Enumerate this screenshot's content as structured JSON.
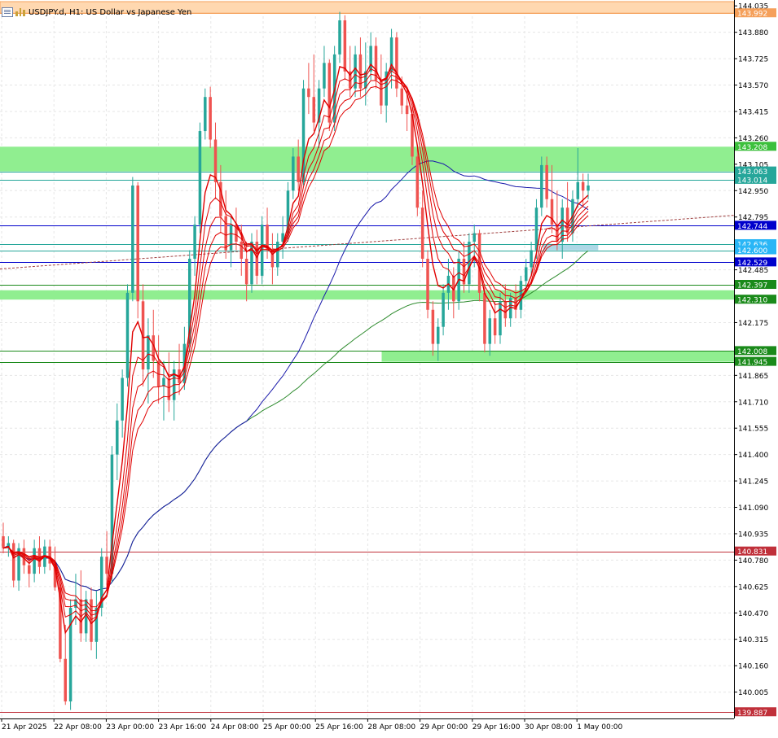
{
  "window": {
    "symbol_title": "USDJPY.d, H1:  US Dollar vs Japanese Yen"
  },
  "colors": {
    "background": "#ffffff",
    "grid": "#e6e6e6",
    "bull_candle": "#26a69a",
    "bear_candle": "#ef5350",
    "ribbon_red": "#e00000",
    "ma_blue": "#1a1aaa",
    "ma_green": "#2e8b2e",
    "zone_green": "#90ee90",
    "zone_orange": "#ffd8b0",
    "level_blue": "#0000cc",
    "level_teal": "#26a69a",
    "level_green": "#1a8a1a",
    "level_red": "#c0303a",
    "trend_dotted": "#a04040",
    "axis_text": "#000000"
  },
  "chart_data": {
    "type": "candlestick",
    "symbol": "USDJPY.d",
    "timeframe": "H1",
    "description": "US Dollar vs Japanese Yen",
    "ylim": [
      139.85,
      144.06
    ],
    "y_ticks": [
      "144.035",
      "143.880",
      "143.725",
      "143.570",
      "143.415",
      "143.260",
      "143.105",
      "142.950",
      "142.795",
      "142.485",
      "142.175",
      "141.865",
      "141.710",
      "141.555",
      "141.400",
      "141.245",
      "141.090",
      "140.935",
      "140.780",
      "140.625",
      "140.470",
      "140.315",
      "140.160",
      "140.005"
    ],
    "x_ticks": [
      "21 Apr 2025",
      "22 Apr 08:00",
      "23 Apr 00:00",
      "23 Apr 16:00",
      "24 Apr 08:00",
      "25 Apr 00:00",
      "25 Apr 16:00",
      "28 Apr 08:00",
      "29 Apr 00:00",
      "29 Apr 16:00",
      "30 Apr 08:00",
      "1 May 00:00"
    ],
    "price_labels": [
      {
        "value": "143.992",
        "price": 143.992,
        "color": "#f5a05a",
        "text_color": "#ffffff"
      },
      {
        "value": "143.208",
        "price": 143.208,
        "color": "#3cc03c",
        "text_color": "#ffffff"
      },
      {
        "value": "143.063",
        "price": 143.063,
        "color": "#26a69a",
        "text_color": "#ffffff"
      },
      {
        "value": "143.014",
        "price": 143.014,
        "color": "#26a69a",
        "text_color": "#ffffff"
      },
      {
        "value": "142.744",
        "price": 142.744,
        "color": "#0000cc",
        "text_color": "#ffffff"
      },
      {
        "value": "142.636",
        "price": 142.636,
        "color": "#29b6f6",
        "text_color": "#ffffff"
      },
      {
        "value": "142.600",
        "price": 142.6,
        "color": "#29b6f6",
        "text_color": "#ffffff"
      },
      {
        "value": "142.529",
        "price": 142.529,
        "color": "#0000cc",
        "text_color": "#ffffff"
      },
      {
        "value": "142.397",
        "price": 142.397,
        "color": "#1a8a1a",
        "text_color": "#ffffff"
      },
      {
        "value": "142.310",
        "price": 142.31,
        "color": "#1a8a1a",
        "text_color": "#ffffff"
      },
      {
        "value": "142.008",
        "price": 142.008,
        "color": "#1a8a1a",
        "text_color": "#ffffff"
      },
      {
        "value": "141.945",
        "price": 141.945,
        "color": "#1a8a1a",
        "text_color": "#ffffff"
      },
      {
        "value": "140.831",
        "price": 140.831,
        "color": "#c0303a",
        "text_color": "#ffffff"
      },
      {
        "value": "139.887",
        "price": 139.887,
        "color": "#c0303a",
        "text_color": "#ffffff"
      }
    ],
    "levels": [
      {
        "price": 143.992,
        "color": "#f5a05a"
      },
      {
        "price": 143.063,
        "color": "#26a69a"
      },
      {
        "price": 143.014,
        "color": "#26a69a"
      },
      {
        "price": 142.744,
        "color": "#0000cc"
      },
      {
        "price": 142.636,
        "color": "#26a69a"
      },
      {
        "price": 142.6,
        "color": "#26a69a"
      },
      {
        "price": 142.529,
        "color": "#0000cc"
      },
      {
        "price": 142.397,
        "color": "#1a8a1a"
      },
      {
        "price": 142.008,
        "color": "#1a8a1a"
      },
      {
        "price": 141.945,
        "color": "#1a8a1a"
      },
      {
        "price": 140.831,
        "color": "#c0303a"
      },
      {
        "price": 139.887,
        "color": "#c0303a"
      }
    ],
    "zones": [
      {
        "top": 144.06,
        "bottom": 143.992,
        "color": "#ffd8b0",
        "border": "#f5a05a",
        "from": 0,
        "to": 1
      },
      {
        "top": 143.208,
        "bottom": 143.063,
        "color": "#90ee90",
        "from": 0,
        "to": 1
      },
      {
        "top": 142.365,
        "bottom": 142.31,
        "color": "#90ee90",
        "from": 0,
        "to": 1
      },
      {
        "top": 142.008,
        "bottom": 141.945,
        "color": "#90ee90",
        "from": 0.52,
        "to": 1
      },
      {
        "top": 142.636,
        "bottom": 142.6,
        "color": "#add8e6",
        "from": 0.74,
        "to": 0.815
      }
    ],
    "trendline": {
      "x1": 0.0,
      "p1": 142.49,
      "x2": 1.0,
      "p2": 142.805
    },
    "candles": [
      [
        140.92,
        141.0,
        140.82,
        140.85
      ],
      [
        140.85,
        140.92,
        140.8,
        140.88
      ],
      [
        140.88,
        140.9,
        140.62,
        140.66
      ],
      [
        140.66,
        140.88,
        140.6,
        140.85
      ],
      [
        140.85,
        140.9,
        140.7,
        140.75
      ],
      [
        140.75,
        140.8,
        140.62,
        140.7
      ],
      [
        140.7,
        140.9,
        140.65,
        140.85
      ],
      [
        140.85,
        140.92,
        140.7,
        140.74
      ],
      [
        140.74,
        140.9,
        140.7,
        140.86
      ],
      [
        140.86,
        140.9,
        140.72,
        140.76
      ],
      [
        140.76,
        140.86,
        140.6,
        140.62
      ],
      [
        140.62,
        140.65,
        140.18,
        140.2
      ],
      [
        140.2,
        140.4,
        139.93,
        139.95
      ],
      [
        139.95,
        140.55,
        139.9,
        140.5
      ],
      [
        140.5,
        140.7,
        140.4,
        140.55
      ],
      [
        140.55,
        140.72,
        140.3,
        140.35
      ],
      [
        140.35,
        140.6,
        140.3,
        140.55
      ],
      [
        140.55,
        140.62,
        140.25,
        140.3
      ],
      [
        140.3,
        140.6,
        140.2,
        140.5
      ],
      [
        140.5,
        140.85,
        140.45,
        140.8
      ],
      [
        140.8,
        140.95,
        140.6,
        140.7
      ],
      [
        140.7,
        141.45,
        140.65,
        141.4
      ],
      [
        141.4,
        141.7,
        141.25,
        141.6
      ],
      [
        141.6,
        141.9,
        141.5,
        141.85
      ],
      [
        141.85,
        142.4,
        141.8,
        142.35
      ],
      [
        142.35,
        143.03,
        142.3,
        142.98
      ],
      [
        142.98,
        143.0,
        142.2,
        142.3
      ],
      [
        142.3,
        142.4,
        141.8,
        141.9
      ],
      [
        141.9,
        142.2,
        141.7,
        142.1
      ],
      [
        142.1,
        142.25,
        141.85,
        141.95
      ],
      [
        141.95,
        142.1,
        141.7,
        141.8
      ],
      [
        141.8,
        141.95,
        141.6,
        141.85
      ],
      [
        141.85,
        142.0,
        141.65,
        141.72
      ],
      [
        141.72,
        141.95,
        141.6,
        141.9
      ],
      [
        141.9,
        142.05,
        141.75,
        141.82
      ],
      [
        141.82,
        142.15,
        141.78,
        142.05
      ],
      [
        142.05,
        142.6,
        142.0,
        142.55
      ],
      [
        142.55,
        142.8,
        142.45,
        142.75
      ],
      [
        142.75,
        143.35,
        142.7,
        143.3
      ],
      [
        143.3,
        143.55,
        143.25,
        143.5
      ],
      [
        143.5,
        143.56,
        143.2,
        143.25
      ],
      [
        143.25,
        143.35,
        142.9,
        143.0
      ],
      [
        143.0,
        143.1,
        142.7,
        142.8
      ],
      [
        142.8,
        142.95,
        142.55,
        142.6
      ],
      [
        142.6,
        142.8,
        142.5,
        142.75
      ],
      [
        142.75,
        142.85,
        142.6,
        142.65
      ],
      [
        142.65,
        142.75,
        142.45,
        142.55
      ],
      [
        142.55,
        142.65,
        142.3,
        142.4
      ],
      [
        142.4,
        142.7,
        142.35,
        142.65
      ],
      [
        142.65,
        142.72,
        142.4,
        142.45
      ],
      [
        142.45,
        142.8,
        142.4,
        142.75
      ],
      [
        142.75,
        142.85,
        142.55,
        142.6
      ],
      [
        142.6,
        142.7,
        142.4,
        142.5
      ],
      [
        142.5,
        142.7,
        142.45,
        142.65
      ],
      [
        142.65,
        142.8,
        142.55,
        142.7
      ],
      [
        142.7,
        143.0,
        142.65,
        142.95
      ],
      [
        142.95,
        143.2,
        142.9,
        143.15
      ],
      [
        143.15,
        143.25,
        142.95,
        143.0
      ],
      [
        143.0,
        143.6,
        142.98,
        143.55
      ],
      [
        143.55,
        143.7,
        143.4,
        143.5
      ],
      [
        143.5,
        143.75,
        143.3,
        143.35
      ],
      [
        143.35,
        143.6,
        143.2,
        143.55
      ],
      [
        143.55,
        143.8,
        143.5,
        143.7
      ],
      [
        143.7,
        143.72,
        143.3,
        143.35
      ],
      [
        143.35,
        143.8,
        143.3,
        143.75
      ],
      [
        143.75,
        144.0,
        143.7,
        143.95
      ],
      [
        143.95,
        143.98,
        143.6,
        143.65
      ],
      [
        143.65,
        143.8,
        143.5,
        143.55
      ],
      [
        143.55,
        143.8,
        143.5,
        143.75
      ],
      [
        143.75,
        143.85,
        143.5,
        143.55
      ],
      [
        143.55,
        143.82,
        143.45,
        143.65
      ],
      [
        143.65,
        143.88,
        143.6,
        143.8
      ],
      [
        143.8,
        143.85,
        143.55,
        143.6
      ],
      [
        143.6,
        143.75,
        143.4,
        143.45
      ],
      [
        143.45,
        143.7,
        143.35,
        143.65
      ],
      [
        143.65,
        143.9,
        143.55,
        143.85
      ],
      [
        143.85,
        143.88,
        143.5,
        143.55
      ],
      [
        143.55,
        143.62,
        143.4,
        143.45
      ],
      [
        143.45,
        143.55,
        143.3,
        143.4
      ],
      [
        143.4,
        143.45,
        143.1,
        143.15
      ],
      [
        143.15,
        143.2,
        142.8,
        142.85
      ],
      [
        142.85,
        142.95,
        142.5,
        142.55
      ],
      [
        142.55,
        142.6,
        142.2,
        142.25
      ],
      [
        142.25,
        142.3,
        141.98,
        142.05
      ],
      [
        142.05,
        142.2,
        141.95,
        142.15
      ],
      [
        142.15,
        142.4,
        142.1,
        142.35
      ],
      [
        142.35,
        142.55,
        142.25,
        142.45
      ],
      [
        142.45,
        142.5,
        142.2,
        142.3
      ],
      [
        142.3,
        142.6,
        142.25,
        142.55
      ],
      [
        142.55,
        142.65,
        142.35,
        142.4
      ],
      [
        142.4,
        142.7,
        142.35,
        142.65
      ],
      [
        142.65,
        142.75,
        142.5,
        142.7
      ],
      [
        142.7,
        142.72,
        142.3,
        142.35
      ],
      [
        142.35,
        142.4,
        142.0,
        142.05
      ],
      [
        142.05,
        142.25,
        141.98,
        142.2
      ],
      [
        142.2,
        142.3,
        142.05,
        142.1
      ],
      [
        142.1,
        142.35,
        142.05,
        142.3
      ],
      [
        142.3,
        142.4,
        142.15,
        142.2
      ],
      [
        142.2,
        142.35,
        142.15,
        142.32
      ],
      [
        142.32,
        142.4,
        142.2,
        142.25
      ],
      [
        142.25,
        142.45,
        142.2,
        142.42
      ],
      [
        142.42,
        142.55,
        142.35,
        142.5
      ],
      [
        142.5,
        142.65,
        142.45,
        142.6
      ],
      [
        142.6,
        142.9,
        142.55,
        142.85
      ],
      [
        142.85,
        143.15,
        142.8,
        143.1
      ],
      [
        143.1,
        143.15,
        142.85,
        142.9
      ],
      [
        142.9,
        143.1,
        142.7,
        142.75
      ],
      [
        142.75,
        142.95,
        142.6,
        142.65
      ],
      [
        142.65,
        142.9,
        142.55,
        142.85
      ],
      [
        142.85,
        143.0,
        142.65,
        142.7
      ],
      [
        142.7,
        142.95,
        142.65,
        142.9
      ],
      [
        142.9,
        143.2,
        142.85,
        143.0
      ],
      [
        143.0,
        143.05,
        142.85,
        142.95
      ],
      [
        142.95,
        143.05,
        142.9,
        142.98
      ]
    ],
    "ribbon_periods": [
      5,
      7,
      9,
      11,
      13
    ],
    "ma_blue_period": 48,
    "ma_green_period": 100
  }
}
